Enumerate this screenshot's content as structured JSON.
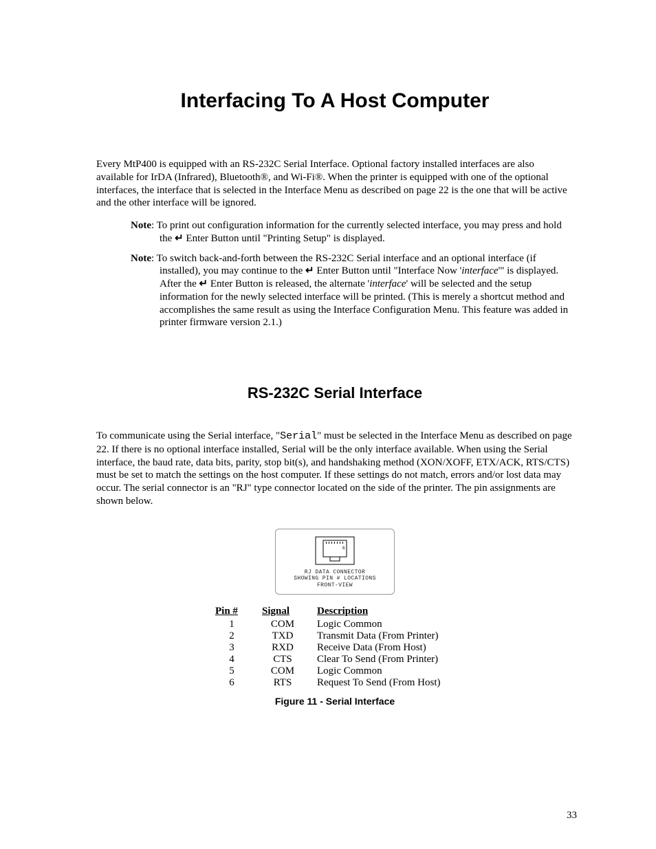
{
  "title": "Interfacing To A Host Computer",
  "intro": "Every MtP400 is equipped with an RS-232C Serial Interface.  Optional factory installed interfaces are also available for IrDA (Infrared), Bluetooth®, and Wi-Fi®.  When the printer is equipped with one of the optional interfaces, the interface that is selected in the Interface Menu as described on page 22 is the one that will be active and the other interface will be ignored.",
  "note1_label": "Note",
  "note1_a": ": To print out configuration information for the currently selected interface, you may press and hold the ",
  "note1_b": " Enter Button until \"Printing Setup\" is displayed.",
  "note2_label": "Note",
  "note2_a": ": To switch back-and-forth between the RS-232C Serial interface and an optional interface (if installed), you may continue to the ",
  "note2_b": " Enter Button until \"Interface Now '",
  "note2_it1": "interface",
  "note2_c": "'\" is displayed.  After the ",
  "note2_d": " Enter Button is released, the alternate '",
  "note2_it2": "interface",
  "note2_e": "' will be selected and the setup information for the newly selected interface will be printed.  (This is merely a shortcut method and accomplishes the same result as using the Interface Configuration Menu.  This feature was added in printer firmware version 2.1.)",
  "enter_glyph": "↵",
  "section": "RS-232C Serial Interface",
  "serial_a": "To communicate using the Serial interface, \"",
  "serial_mono": "Serial",
  "serial_b": "\" must be selected in the Interface Menu as described on page 22.  If there is no optional interface installed, Serial will be the only interface available.  When using the Serial interface, the baud rate, data bits, parity, stop bit(s), and handshaking method (XON/XOFF, ETX/ACK, RTS/CTS) must be set to match the settings on the host computer.  If these settings do not match, errors and/or lost data may occur.  The serial connector is an \"RJ\" type connector located on the side of the printer.  The pin assignments are shown below.",
  "connector_line1": "RJ DATA CONNECTOR",
  "connector_line2": "SHOWING PIN # LOCATIONS",
  "connector_line3": "FRONT-VIEW",
  "headers": {
    "pin": "Pin #",
    "signal": "Signal",
    "desc": "Description"
  },
  "pins": [
    {
      "pin": "1",
      "signal": "COM",
      "desc": "Logic Common"
    },
    {
      "pin": "2",
      "signal": "TXD",
      "desc": "Transmit Data (From Printer)"
    },
    {
      "pin": "3",
      "signal": "RXD",
      "desc": "Receive Data (From Host)"
    },
    {
      "pin": "4",
      "signal": "CTS",
      "desc": "Clear To Send (From Printer)"
    },
    {
      "pin": "5",
      "signal": "COM",
      "desc": "Logic Common"
    },
    {
      "pin": "6",
      "signal": "RTS",
      "desc": "Request To Send (From Host)"
    }
  ],
  "caption": "Figure 11 - Serial Interface",
  "page_number": "33"
}
